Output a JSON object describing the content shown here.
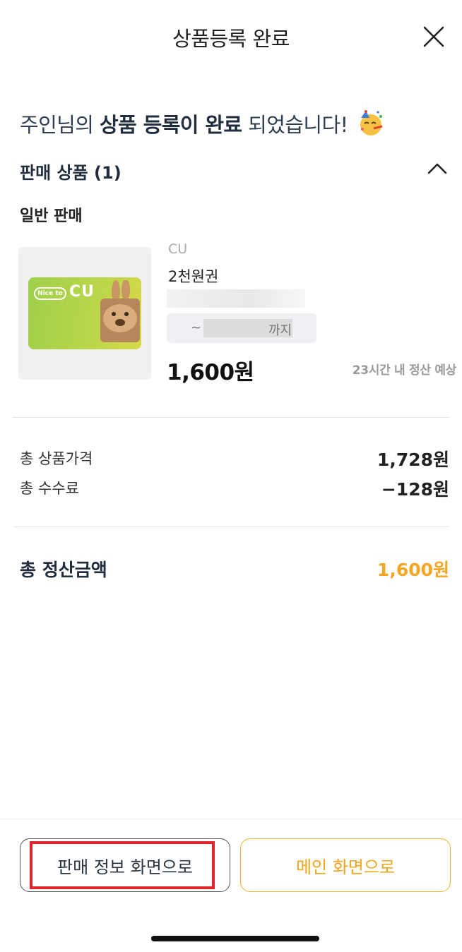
{
  "header": {
    "title": "상품등록 완료"
  },
  "headline": {
    "prefix": "주인님의 ",
    "bold1": "상품 등록이 완료",
    "suffix": " 되었습니다!"
  },
  "section": {
    "title": "판매 상품 (1)",
    "subtitle": "일반 판매"
  },
  "product": {
    "brand": "CU",
    "name": "2천원권",
    "period_prefix": "~",
    "period_suffix": "까지",
    "price": "1,600원",
    "settlement_note": "23시간 내 정산 예상",
    "card_logo_text": "Nice to",
    "card_brand_text": "CU"
  },
  "summary": {
    "total_price_label": "총 상품가격",
    "total_price_value": "1,728원",
    "fee_label": "총 수수료",
    "fee_value": "−128원",
    "settlement_label": "총 정산금액",
    "settlement_value": "1,600원"
  },
  "footer": {
    "left_button": "판매 정보 화면으로",
    "right_button": "메인 화면으로"
  },
  "colors": {
    "accent": "#f5a623",
    "highlight": "#e0262d"
  }
}
